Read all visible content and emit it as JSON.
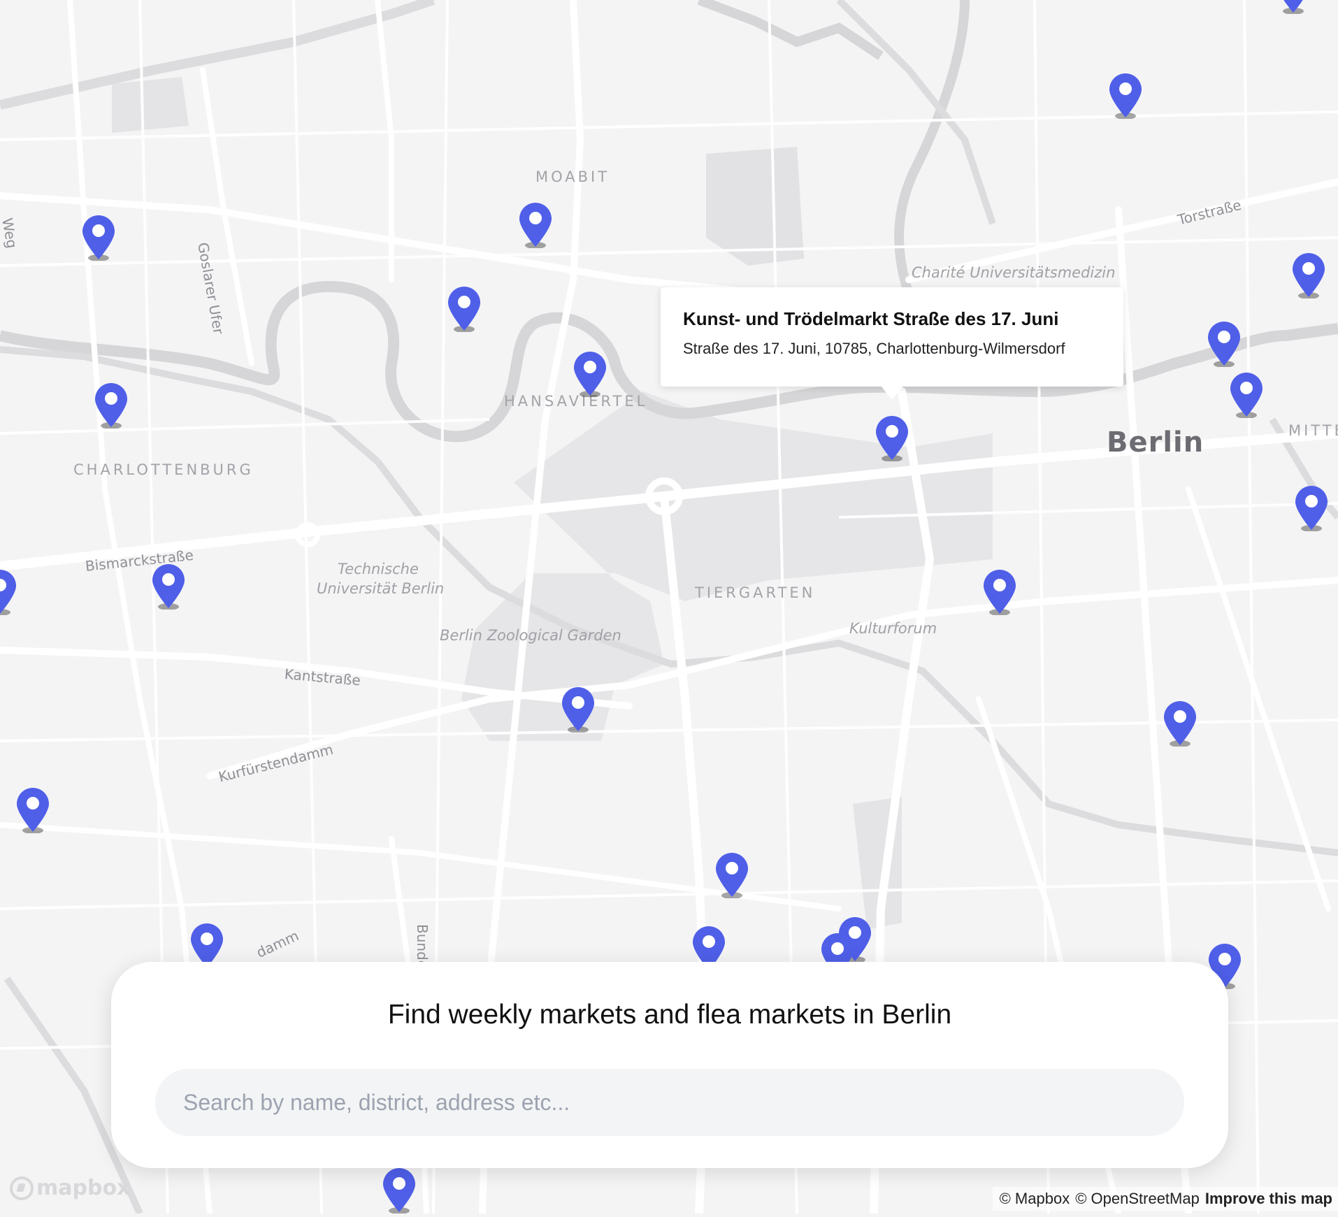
{
  "map": {
    "district_labels": [
      "MOABIT",
      "HANSAVIERTEL",
      "CHARLOTTENBURG",
      "TIERGARTEN",
      "MITTE"
    ],
    "poi_labels": [
      "Charité Universitätsmedizin",
      "Technische",
      "Universität Berlin",
      "Berlin Zoological Garden",
      "Kulturforum"
    ],
    "street_labels": [
      "Torstraße",
      "Goslarer Ufer",
      "Bismarckstraße",
      "Kantstraße",
      "Kurfürstendamm",
      "Bunde",
      "damm",
      "Weg"
    ],
    "city_label": "Berlin",
    "marker_color": "#4f5fe8"
  },
  "popup": {
    "title": "Kunst- und Trödelmarkt Straße des 17. Juni",
    "address": "Straße des 17. Juni, 10785, Charlottenburg-Wilmersdorf"
  },
  "panel": {
    "title": "Find weekly markets and flea markets in Berlin",
    "search_placeholder": "Search by name, district, address etc..."
  },
  "logo": "mapbox",
  "attribution": {
    "mapbox": "© Mapbox",
    "osm": "© OpenStreetMap",
    "improve": "Improve this map"
  }
}
